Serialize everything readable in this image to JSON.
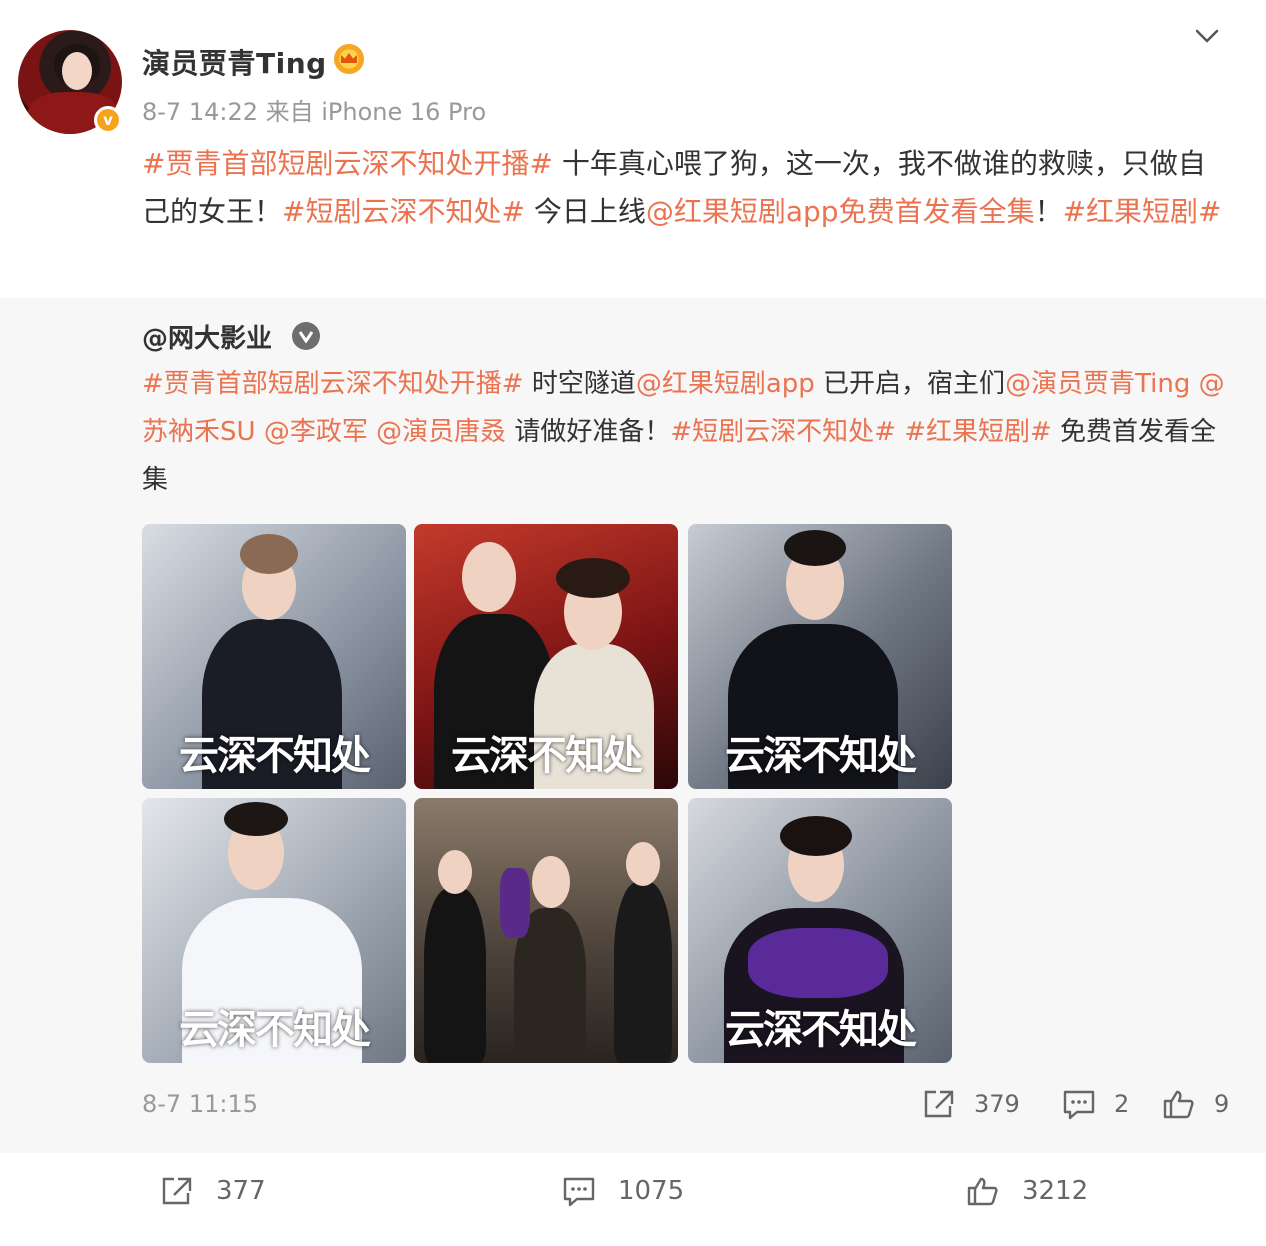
{
  "author": {
    "name": "演员贾青Ting",
    "avatar_badge": "v",
    "meta": "8-7 14:22 来自 iPhone 16 Pro"
  },
  "post": {
    "segments": [
      {
        "text": "#贾青首部短剧云深不知处开播#",
        "link": true
      },
      {
        "text": " 十年真心喂了狗，这一次，我不做谁的救赎，只做自己的女王！",
        "link": false
      },
      {
        "text": "#短剧云深不知处#",
        "link": true
      },
      {
        "text": " 今日上线",
        "link": false
      },
      {
        "text": "@红果短剧app免费首发看全集",
        "link": true
      },
      {
        "text": "！",
        "link": false
      },
      {
        "text": "#红果短剧#",
        "link": true
      }
    ]
  },
  "repost": {
    "author": "@网大影业",
    "segments": [
      {
        "text": "#贾青首部短剧云深不知处开播#",
        "link": true
      },
      {
        "text": " 时空隧道",
        "link": false
      },
      {
        "text": "@红果短剧app",
        "link": true
      },
      {
        "text": " 已开启，宿主们",
        "link": false
      },
      {
        "text": "@演员贾青Ting",
        "link": true
      },
      {
        "text": " ",
        "link": false
      },
      {
        "text": "@苏衲禾SU",
        "link": true
      },
      {
        "text": " ",
        "link": false
      },
      {
        "text": "@李政军",
        "link": true
      },
      {
        "text": " ",
        "link": false
      },
      {
        "text": "@演员唐叒",
        "link": true
      },
      {
        "text": " 请做好准备！",
        "link": false
      },
      {
        "text": "#短剧云深不知处#",
        "link": true
      },
      {
        "text": " ",
        "link": false
      },
      {
        "text": "#红果短剧#",
        "link": true
      },
      {
        "text": " 免费首发看全集",
        "link": false
      }
    ],
    "poster_title": "云深不知处",
    "time": "8-7 11:15",
    "shares": "379",
    "comments": "2",
    "likes": "9"
  },
  "actions": {
    "shares": "377",
    "comments": "1075",
    "likes": "3212"
  },
  "colors": {
    "link": "#eb7350",
    "muted": "#999999",
    "text": "#333333",
    "repost_bg": "#f7f7f7",
    "verified_orange": "#f7a21b"
  },
  "icons": [
    "chevron-down-icon",
    "crown-icon",
    "share-icon",
    "comment-icon",
    "like-icon",
    "verified-icon"
  ]
}
